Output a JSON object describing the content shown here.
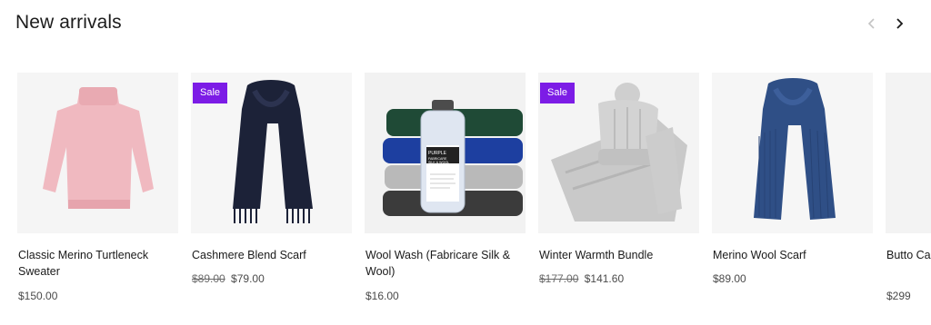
{
  "section": {
    "title": "New arrivals"
  },
  "nav": {
    "prev_icon": "chevron-left-icon",
    "next_icon": "chevron-right-icon"
  },
  "colors": {
    "badge_bg": "#7c1ce6",
    "image_bg": "#f4f4f4"
  },
  "products": [
    {
      "title": "Classic Merino Turtleneck Sweater",
      "price": "$150.00",
      "old_price": "",
      "badge": ""
    },
    {
      "title": "Cashmere Blend Scarf",
      "price": "$79.00",
      "old_price": "$89.00",
      "badge": "Sale"
    },
    {
      "title": "Wool Wash (Fabricare Silk & Wool)",
      "price": "$16.00",
      "old_price": "",
      "badge": "",
      "bottle_label": {
        "brand": "PURPLE",
        "line1": "FABRICARE",
        "line2": "SILK & WOOL"
      }
    },
    {
      "title": "Winter Warmth Bundle",
      "price": "$141.60",
      "old_price": "$177.00",
      "badge": "Sale"
    },
    {
      "title": "Merino Wool Scarf",
      "price": "$89.00",
      "old_price": "",
      "badge": ""
    },
    {
      "title": "Butto Card",
      "price": "$299",
      "old_price": "",
      "badge": ""
    }
  ]
}
